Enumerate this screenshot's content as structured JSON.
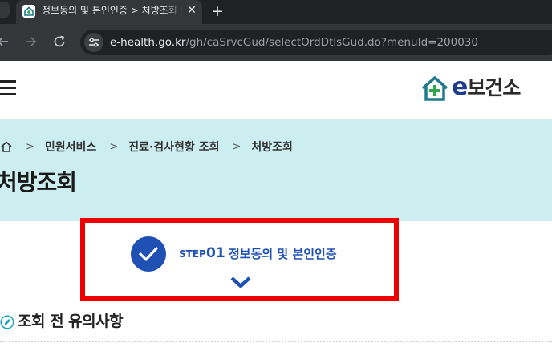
{
  "browser": {
    "tab_title": "정보동의 및 본인인증 > 처방조회 | e보건소",
    "tab_close": "✕",
    "new_tab": "+",
    "url_host": "e-health.go.kr",
    "url_path": "/gh/caSrvcGud/selectOrdDtlsGud.do?menuId=200030"
  },
  "site": {
    "logo_e": "e",
    "logo_name": "보건소",
    "colors": {
      "brand_blue": "#1f50b4",
      "banner_bg": "#cceef1",
      "highlight_red": "#ee0000"
    }
  },
  "breadcrumb": {
    "items": [
      "민원서비스",
      "진료·검사현황 조회",
      "처방조회"
    ],
    "separator": ">"
  },
  "page": {
    "title": "처방조회"
  },
  "step": {
    "label": "STEP",
    "number": "01",
    "title": "정보동의 및 본인인증",
    "status_icon": "check-circle-icon",
    "expand_icon": "chevron-down-icon"
  },
  "notice": {
    "title": "조회 전 유의사항",
    "icon": "pencil-circle-icon"
  }
}
